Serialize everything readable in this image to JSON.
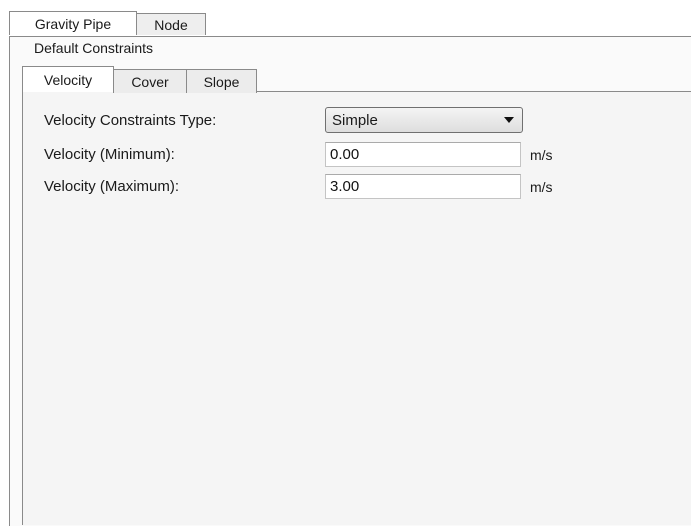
{
  "outer_tabs": [
    {
      "label": "Gravity Pipe",
      "active": true
    },
    {
      "label": "Node",
      "active": false
    }
  ],
  "group": {
    "title": "Default Constraints"
  },
  "inner_tabs": [
    {
      "label": "Velocity",
      "active": true
    },
    {
      "label": "Cover",
      "active": false
    },
    {
      "label": "Slope",
      "active": false
    }
  ],
  "velocity": {
    "type_label": "Velocity Constraints Type:",
    "type_value": "Simple",
    "min_label": "Velocity (Minimum):",
    "min_value": "0.00",
    "min_unit": "m/s",
    "max_label": "Velocity (Maximum):",
    "max_value": "3.00",
    "max_unit": "m/s"
  }
}
